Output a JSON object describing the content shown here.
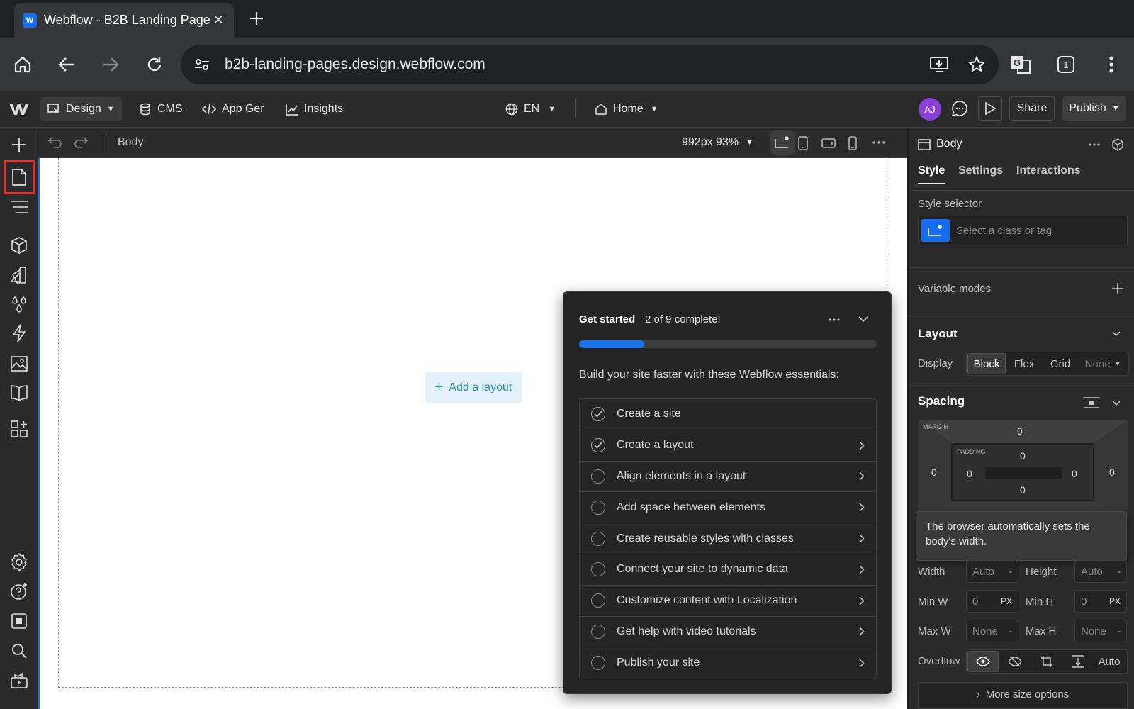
{
  "browser": {
    "tab_title": "Webflow - B2B Landing Page",
    "url": "b2b-landing-pages.design.webflow.com",
    "tab_count": "1"
  },
  "topbar": {
    "design_label": "Design",
    "cms_label": "CMS",
    "appgen_label": "App Ger",
    "insights_label": "Insights",
    "locale": "EN",
    "page": "Home",
    "avatar_initials": "AJ",
    "share_label": "Share",
    "publish_label": "Publish"
  },
  "canvas_bar": {
    "breadcrumb": "Body",
    "viewport": "992px 93%"
  },
  "canvas": {
    "add_layout_label": "Add a layout"
  },
  "get_started": {
    "title": "Get started",
    "progress_text": "2 of 9 complete!",
    "progress_fraction": 0.22,
    "intro": "Build your site faster with these Webflow essentials:",
    "items": [
      {
        "label": "Create a site",
        "done": true,
        "arrow": false
      },
      {
        "label": "Create a layout",
        "done": true,
        "arrow": true
      },
      {
        "label": "Align elements in a layout",
        "done": false,
        "arrow": true
      },
      {
        "label": "Add space between elements",
        "done": false,
        "arrow": true
      },
      {
        "label": "Create reusable styles with classes",
        "done": false,
        "arrow": true
      },
      {
        "label": "Connect your site to dynamic data",
        "done": false,
        "arrow": true
      },
      {
        "label": "Customize content with Localization",
        "done": false,
        "arrow": true
      },
      {
        "label": "Get help with video tutorials",
        "done": false,
        "arrow": true
      },
      {
        "label": "Publish your site",
        "done": false,
        "arrow": true
      }
    ]
  },
  "right_panel": {
    "element_name": "Body",
    "tabs": {
      "style": "Style",
      "settings": "Settings",
      "interactions": "Interactions"
    },
    "style_selector_label": "Style selector",
    "selector_placeholder": "Select a class or tag",
    "variable_modes": "Variable modes",
    "layout_title": "Layout",
    "display_label": "Display",
    "display_options": {
      "block": "Block",
      "flex": "Flex",
      "grid": "Grid",
      "none": "None"
    },
    "spacing_title": "Spacing",
    "margin_label": "MARGIN",
    "padding_label": "PADDING",
    "margin": {
      "top": "0",
      "left": "0",
      "right": "0"
    },
    "padding": {
      "top": "0",
      "left": "0",
      "right": "0",
      "bottom": "0"
    },
    "tooltip": "The browser automatically sets the body's width.",
    "size": {
      "width_label": "Width",
      "width_value": "Auto",
      "width_unit": "-",
      "height_label": "Height",
      "height_value": "Auto",
      "height_unit": "-",
      "minw_label": "Min W",
      "minw_value": "0",
      "minw_unit": "PX",
      "minh_label": "Min H",
      "minh_value": "0",
      "minh_unit": "PX",
      "maxw_label": "Max W",
      "maxw_value": "None",
      "maxw_unit": "-",
      "maxh_label": "Max H",
      "maxh_value": "None",
      "maxh_unit": "-"
    },
    "overflow_label": "Overflow",
    "overflow_auto": "Auto",
    "more_size": "More size options"
  }
}
